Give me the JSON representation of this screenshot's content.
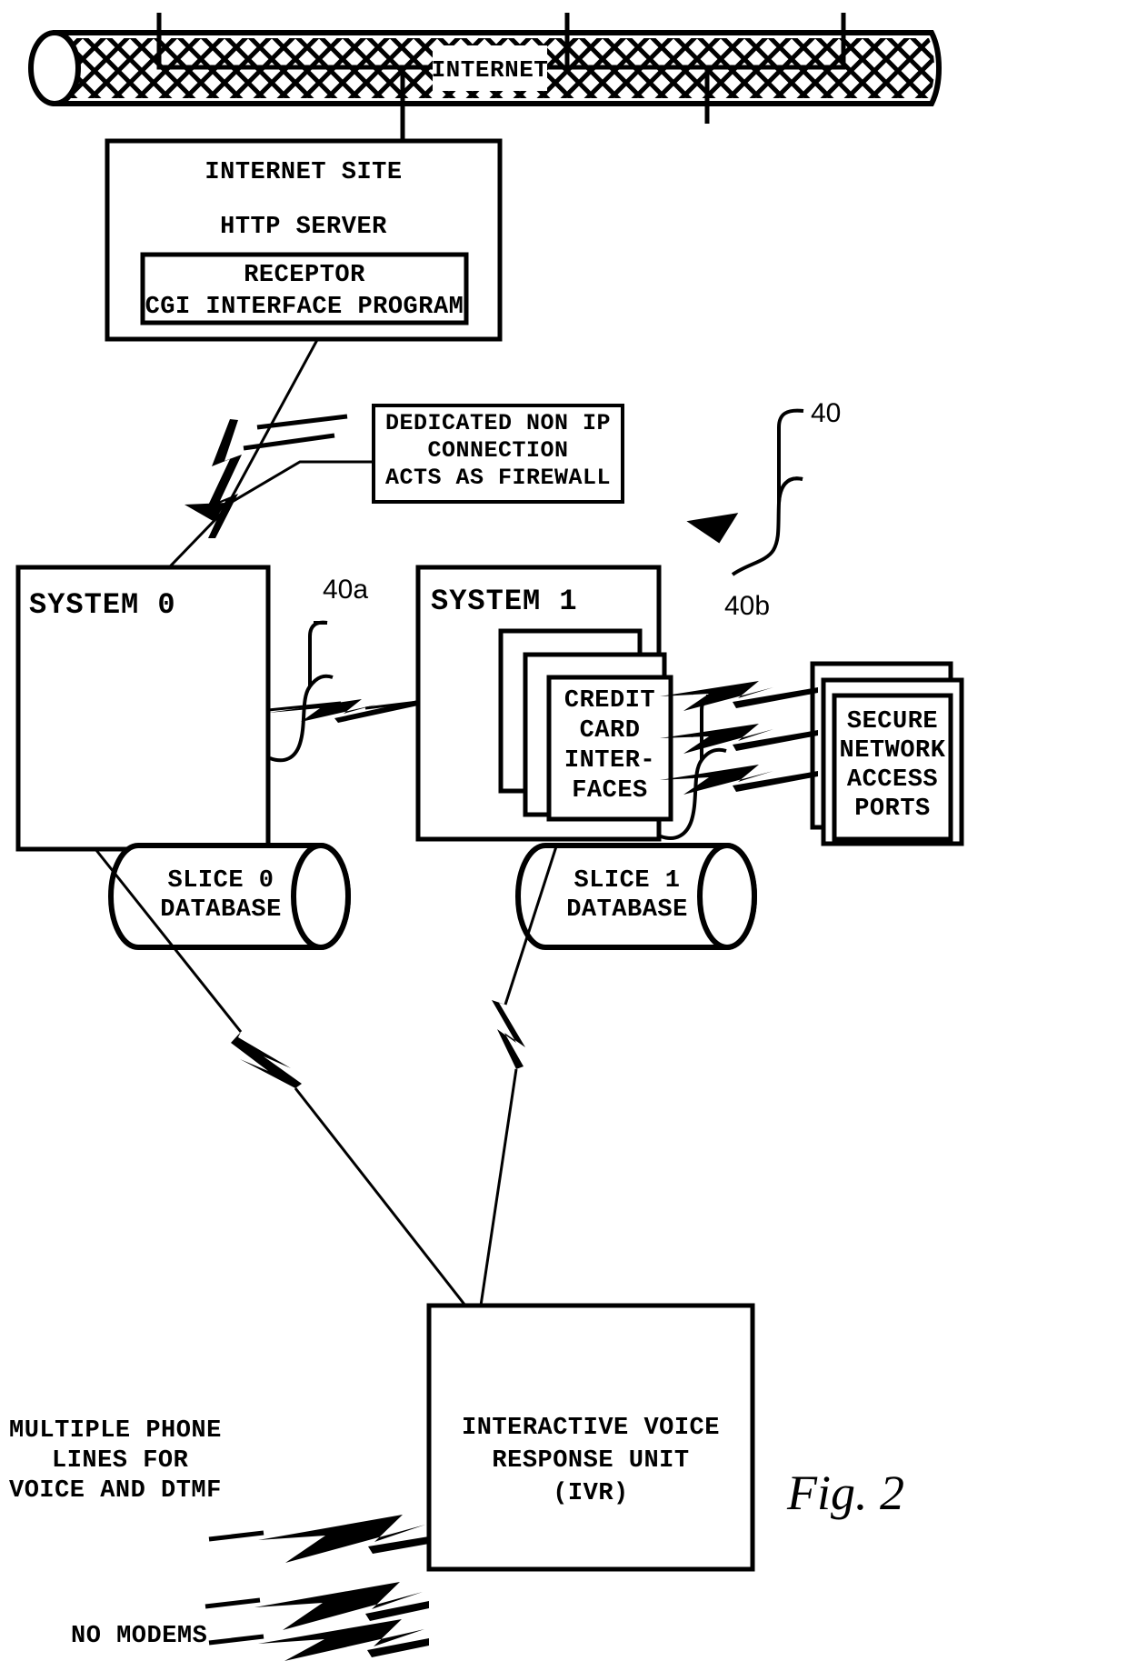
{
  "figure": {
    "label": "Fig. 2",
    "reference_numerals": {
      "system_pair": "40",
      "system_0": "40a",
      "system_1": "40b"
    }
  },
  "network": {
    "backbone_label": "INTERNET"
  },
  "nodes": {
    "internet_site": {
      "line1": "INTERNET SITE",
      "line2": "HTTP SERVER",
      "inner": {
        "line1": "RECEPTOR",
        "line2": "CGI INTERFACE PROGRAM"
      }
    },
    "firewall_note": {
      "line1": "DEDICATED NON IP",
      "line2": "CONNECTION",
      "line3": "ACTS AS FIREWALL"
    },
    "system0": {
      "title": "SYSTEM 0"
    },
    "system1": {
      "title": "SYSTEM 1",
      "credit_card": {
        "line1": "CREDIT",
        "line2": "CARD",
        "line3": "INTER-",
        "line4": "FACES"
      }
    },
    "secure_ports": {
      "line1": "SECURE",
      "line2": "NETWORK",
      "line3": "ACCESS",
      "line4": "PORTS"
    },
    "slice0_db": {
      "line1": "SLICE 0",
      "line2": "DATABASE"
    },
    "slice1_db": {
      "line1": "SLICE 1",
      "line2": "DATABASE"
    },
    "ivr": {
      "line1": "INTERACTIVE VOICE",
      "line2": "RESPONSE UNIT",
      "line3": "(IVR)"
    }
  },
  "annotations": {
    "phone_lines": {
      "line1": "MULTIPLE PHONE",
      "line2": "LINES FOR",
      "line3": "VOICE AND DTMF"
    },
    "no_modems": "NO MODEMS"
  },
  "colors": {
    "ink": "#000000",
    "paper": "#ffffff"
  }
}
